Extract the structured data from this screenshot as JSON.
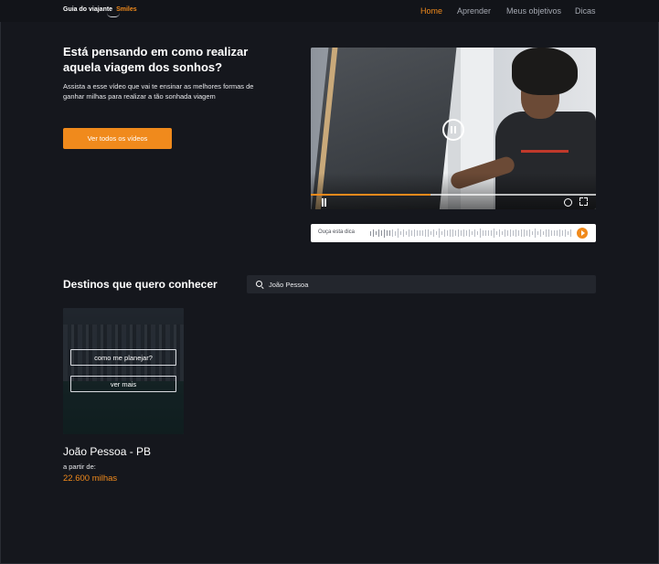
{
  "nav": {
    "logo_text": "Guia do viajante",
    "logo_brand": "Smiles",
    "links": [
      {
        "label": "Home",
        "active": true
      },
      {
        "label": "Aprender",
        "active": false
      },
      {
        "label": "Meus objetivos",
        "active": false
      },
      {
        "label": "Dicas",
        "active": false
      }
    ]
  },
  "hero": {
    "title": "Está pensando em como realizar aquela viagem dos sonhos?",
    "subtitle": "Assista a esse vídeo que vai te ensinar as melhores formas de ganhar milhas para realizar a tão sonhada viagem",
    "cta_label": "Ver todos os vídeos"
  },
  "video": {
    "progress": 0.42,
    "state": "paused-overlay",
    "icons": [
      "pause-circle-icon",
      "pause-icon",
      "clock-icon",
      "fullscreen-icon"
    ]
  },
  "audio": {
    "label": "Ouça esta dica",
    "icon": "play-icon"
  },
  "destinations": {
    "title": "Destinos que quero conhecer",
    "search": {
      "value": "João Pessoa",
      "icon": "search-icon"
    },
    "cards": [
      {
        "button_plan": "como me planejar?",
        "button_more": "ver mais",
        "name": "João Pessoa - PB",
        "from_label": "a partir de:",
        "price": "22.600 milhas"
      }
    ]
  },
  "colors": {
    "accent": "#f08a1c",
    "background": "#15171d",
    "nav_background": "#121419",
    "input_background": "#23262d"
  }
}
